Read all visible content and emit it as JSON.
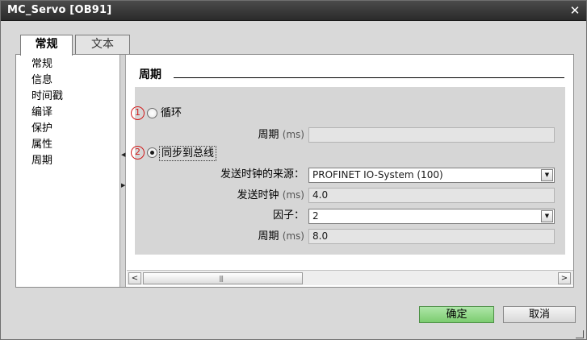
{
  "window": {
    "title": "MC_Servo [OB91]",
    "close_glyph": "✕"
  },
  "tabs": [
    {
      "label": "常规",
      "active": true
    },
    {
      "label": "文本",
      "active": false
    }
  ],
  "nav": {
    "items": [
      "常规",
      "信息",
      "时间戳",
      "编译",
      "保护",
      "属性",
      "周期"
    ],
    "selected": "周期"
  },
  "section": {
    "title": "周期"
  },
  "options": {
    "cyclic": {
      "marker": "1",
      "label": "循环",
      "selected": false,
      "period_label": "周期",
      "period_unit": "(ms)",
      "period_value": ""
    },
    "bus_sync": {
      "marker": "2",
      "label": "同步到总线",
      "selected": true,
      "clock_source_label": "发送时钟的来源：",
      "clock_source_value": "PROFINET IO-System (100)",
      "send_clock_label": "发送时钟",
      "send_clock_unit": "(ms)",
      "send_clock_value": "4.0",
      "factor_label": "因子：",
      "factor_value": "2",
      "period_label": "周期",
      "period_unit": "(ms)",
      "period_value": "8.0"
    }
  },
  "scrollbar": {
    "left_arrow": "<",
    "right_arrow": ">",
    "grip": "|||"
  },
  "buttons": {
    "ok": "确定",
    "cancel": "取消"
  },
  "colors": {
    "ok_button": "#7ccc70",
    "marker": "#d11a1a",
    "titlebar": "#2a2a2a"
  }
}
